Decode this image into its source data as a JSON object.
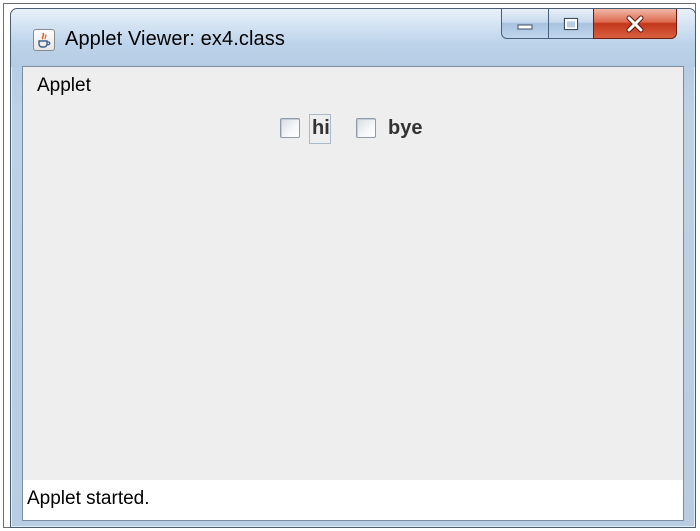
{
  "window": {
    "title": "Applet Viewer: ex4.class",
    "icon": "java-cup-icon",
    "controls": [
      "minimize-icon",
      "maximize-icon",
      "close-icon"
    ]
  },
  "menubar": {
    "items": [
      {
        "label": "Applet"
      }
    ]
  },
  "applet": {
    "checkboxes": [
      {
        "label": "hi",
        "checked": false,
        "focused": true
      },
      {
        "label": "bye",
        "checked": false,
        "focused": false
      }
    ]
  },
  "status": {
    "text": "Applet started."
  },
  "colors": {
    "close_button": "#c9462a",
    "client_background": "#eeeeee",
    "titlebar": "#bdd3ea"
  }
}
